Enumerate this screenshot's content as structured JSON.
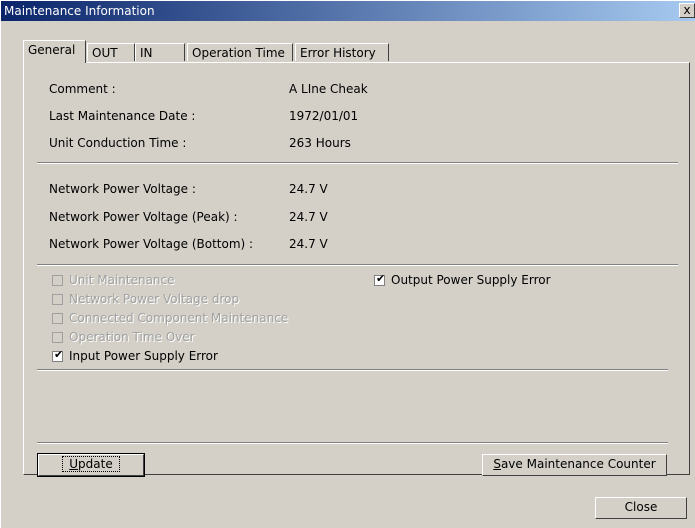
{
  "window": {
    "title": "Maintenance Information",
    "close_glyph": "x"
  },
  "tabs": [
    {
      "label": "General"
    },
    {
      "label": "OUT"
    },
    {
      "label": "IN"
    },
    {
      "label": "Operation Time"
    },
    {
      "label": "Error History"
    }
  ],
  "info": {
    "comment_label": "Comment :",
    "comment_value": "A LIne Cheak",
    "last_maint_label": "Last Maintenance Date :",
    "last_maint_value": "1972/01/01",
    "conduction_label": "Unit Conduction Time :",
    "conduction_value": "263 Hours"
  },
  "voltage": {
    "npv_label": "Network Power Voltage :",
    "npv_value": "24.7 V",
    "npv_peak_label": "Network Power Voltage (Peak) :",
    "npv_peak_value": "24.7 V",
    "npv_bottom_label": "Network Power Voltage (Bottom) :",
    "npv_bottom_value": "24.7 V"
  },
  "flags": {
    "unit_maintenance": {
      "label": "Unit Maintenance",
      "checked": false,
      "enabled": false
    },
    "npv_drop": {
      "label": "Network Power Voltage drop",
      "checked": false,
      "enabled": false
    },
    "connected_component": {
      "label": "Connected Component Maintenance",
      "checked": false,
      "enabled": false
    },
    "operation_time_over": {
      "label": "Operation Time Over",
      "checked": false,
      "enabled": false
    },
    "input_power_error": {
      "label": "Input Power Supply Error",
      "checked": true,
      "enabled": true
    },
    "output_power_error": {
      "label": "Output Power Supply Error",
      "checked": true,
      "enabled": true
    }
  },
  "buttons": {
    "update_accel": "U",
    "update_rest": "pdate",
    "save_accel": "S",
    "save_rest": "ave Maintenance Counter",
    "close": "Close"
  }
}
